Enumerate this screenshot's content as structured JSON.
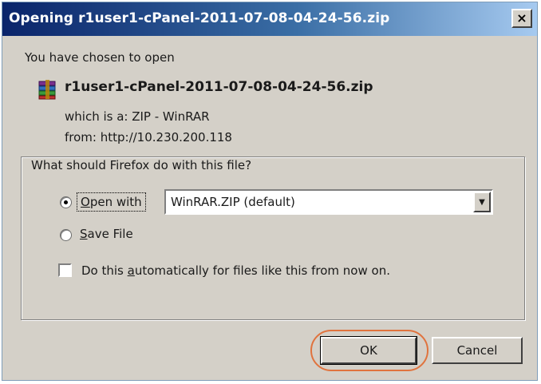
{
  "window": {
    "title": "Opening r1user1-cPanel-2011-07-08-04-24-56.zip",
    "close_glyph": "×"
  },
  "info": {
    "chosen_text": "You have chosen to open",
    "file_name": "r1user1-cPanel-2011-07-08-04-24-56.zip",
    "file_icon": "winrar-archive-icon",
    "which_is": "which is a: ZIP - WinRAR",
    "from": "from: http://10.230.200.118"
  },
  "action_group": {
    "legend": "What should Firefox do with this file?",
    "open_with": {
      "label_pre": "",
      "label_accel": "O",
      "label_post": "pen with",
      "selected": true
    },
    "app_select": {
      "value": "WinRAR.ZIP (default)"
    },
    "save_file": {
      "label_accel": "S",
      "label_post": "ave File",
      "selected": false
    },
    "auto_checkbox": {
      "label_pre": "Do this ",
      "label_accel": "a",
      "label_post": "utomatically for files like this from now on.",
      "checked": false
    }
  },
  "buttons": {
    "ok": "OK",
    "cancel": "Cancel"
  },
  "colors": {
    "dialog_bg": "#d4d0c8",
    "titlebar_start": "#0a246a",
    "titlebar_end": "#a6caf0",
    "highlight_ring": "#e0733e"
  }
}
